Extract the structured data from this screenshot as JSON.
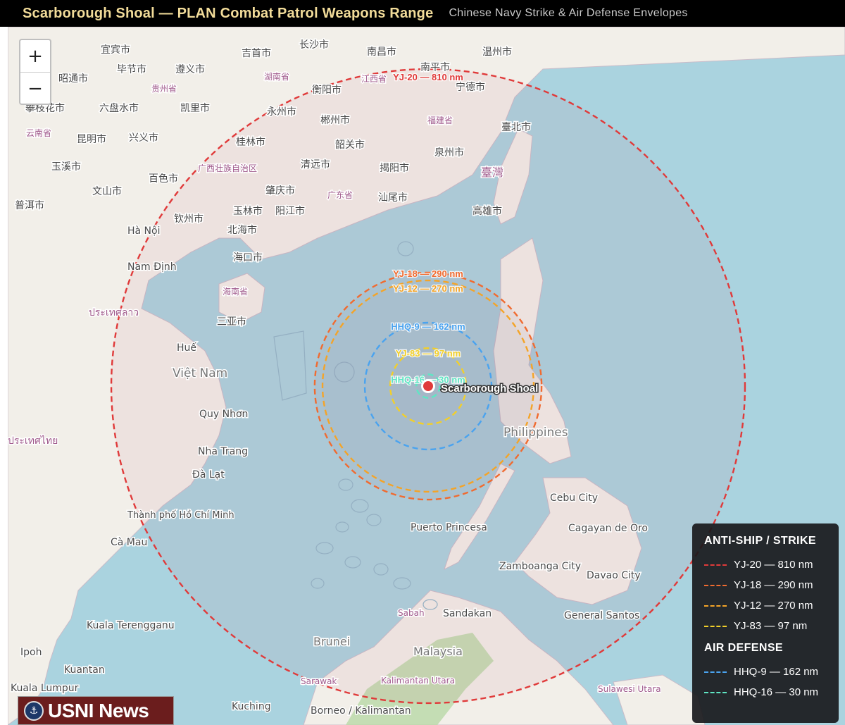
{
  "header": {
    "title": "Scarborough Shoal — PLAN Combat Patrol Weapons Range",
    "subtitle": "Chinese Navy Strike & Air Defense Envelopes"
  },
  "zoom": {
    "in_label": "+",
    "out_label": "−"
  },
  "target": {
    "name": "Scarborough Shoal",
    "lat": 15.15,
    "lon": 117.76,
    "marker_color": "#e03a3a"
  },
  "ranges": [
    {
      "id": "yj20",
      "label": "YJ-20 — 810 nm",
      "nm": 810,
      "color": "#e03a3a"
    },
    {
      "id": "yj18",
      "label": "YJ-18 — 290 nm",
      "nm": 290,
      "color": "#f06b30"
    },
    {
      "id": "yj12",
      "label": "YJ-12 — 270 nm",
      "nm": 270,
      "color": "#f4a428"
    },
    {
      "id": "yj83",
      "label": "YJ-83 — 97 nm",
      "nm": 97,
      "color": "#f2cf2a"
    },
    {
      "id": "hhq9",
      "label": "HHQ-9 — 162 nm",
      "nm": 162,
      "color": "#4aa3ef"
    },
    {
      "id": "hhq16",
      "label": "HHQ-16 — 30 nm",
      "nm": 30,
      "color": "#5fe6c4"
    }
  ],
  "legend": {
    "strike_heading": "ANTI-SHIP / STRIKE",
    "defense_heading": "AIR DEFENSE",
    "strike_items": [
      {
        "label": "YJ-20 — 810 nm",
        "color": "#e03a3a"
      },
      {
        "label": "YJ-18 — 290 nm",
        "color": "#f06b30"
      },
      {
        "label": "YJ-12 — 270 nm",
        "color": "#f4a428"
      },
      {
        "label": "YJ-83 — 97 nm",
        "color": "#f2cf2a"
      }
    ],
    "defense_items": [
      {
        "label": "HHQ-9 — 162 nm",
        "color": "#4aa3ef"
      },
      {
        "label": "HHQ-16 — 30 nm",
        "color": "#5fe6c4"
      }
    ]
  },
  "place_labels": [
    {
      "name": "宜宾市"
    },
    {
      "name": "毕节市"
    },
    {
      "name": "遵义市"
    },
    {
      "name": "吉首市"
    },
    {
      "name": "长沙市"
    },
    {
      "name": "南昌市"
    },
    {
      "name": "温州市"
    },
    {
      "name": "昭通市"
    },
    {
      "name": "贵州省"
    },
    {
      "name": "湖南省"
    },
    {
      "name": "衡阳市"
    },
    {
      "name": "江西省"
    },
    {
      "name": "南平市"
    },
    {
      "name": "宁德市"
    },
    {
      "name": "攀枝花市"
    },
    {
      "name": "六盘水市"
    },
    {
      "name": "凯里市"
    },
    {
      "name": "永州市"
    },
    {
      "name": "郴州市"
    },
    {
      "name": "福建省"
    },
    {
      "name": "云南省"
    },
    {
      "name": "昆明市"
    },
    {
      "name": "兴义市"
    },
    {
      "name": "桂林市"
    },
    {
      "name": "韶关市"
    },
    {
      "name": "泉州市"
    },
    {
      "name": "臺北市"
    },
    {
      "name": "玉溪市"
    },
    {
      "name": "百色市"
    },
    {
      "name": "广西壮族自治区"
    },
    {
      "name": "清远市"
    },
    {
      "name": "揭阳市"
    },
    {
      "name": "臺灣"
    },
    {
      "name": "文山市"
    },
    {
      "name": "肇庆市"
    },
    {
      "name": "广东省"
    },
    {
      "name": "汕尾市"
    },
    {
      "name": "普洱市"
    },
    {
      "name": "玉林市"
    },
    {
      "name": "阳江市"
    },
    {
      "name": "高雄市"
    },
    {
      "name": "钦州市"
    },
    {
      "name": "Hà Nội"
    },
    {
      "name": "北海市"
    },
    {
      "name": "海口市"
    },
    {
      "name": "Nam Định"
    },
    {
      "name": "海南省"
    },
    {
      "name": "三亚市"
    },
    {
      "name": "ประเทศลาว"
    },
    {
      "name": "Huế"
    },
    {
      "name": "Việt Nam"
    },
    {
      "name": "Quy Nhơn"
    },
    {
      "name": "ประเทศไทย"
    },
    {
      "name": "Nha Trang"
    },
    {
      "name": "Đà Lạt"
    },
    {
      "name": "Philippines"
    },
    {
      "name": "Cebu City"
    },
    {
      "name": "Thành phố Hồ Chí Minh"
    },
    {
      "name": "Puerto Princesa"
    },
    {
      "name": "Cagayan de Oro"
    },
    {
      "name": "Cà Mau"
    },
    {
      "name": "Zamboanga City"
    },
    {
      "name": "Davao City"
    },
    {
      "name": "Sabah"
    },
    {
      "name": "Sandakan"
    },
    {
      "name": "General Santos"
    },
    {
      "name": "Kuala Terengganu"
    },
    {
      "name": "Brunei"
    },
    {
      "name": "Malaysia"
    },
    {
      "name": "Ipoh"
    },
    {
      "name": "Kuantan"
    },
    {
      "name": "Sarawak"
    },
    {
      "name": "Kalimantan Utara"
    },
    {
      "name": "Sulawesi Utara"
    },
    {
      "name": "Kuala Lumpur"
    },
    {
      "name": "Kuching"
    },
    {
      "name": "Borneo / Kalimantan"
    }
  ],
  "branding": {
    "logo_text": "USNI News"
  }
}
